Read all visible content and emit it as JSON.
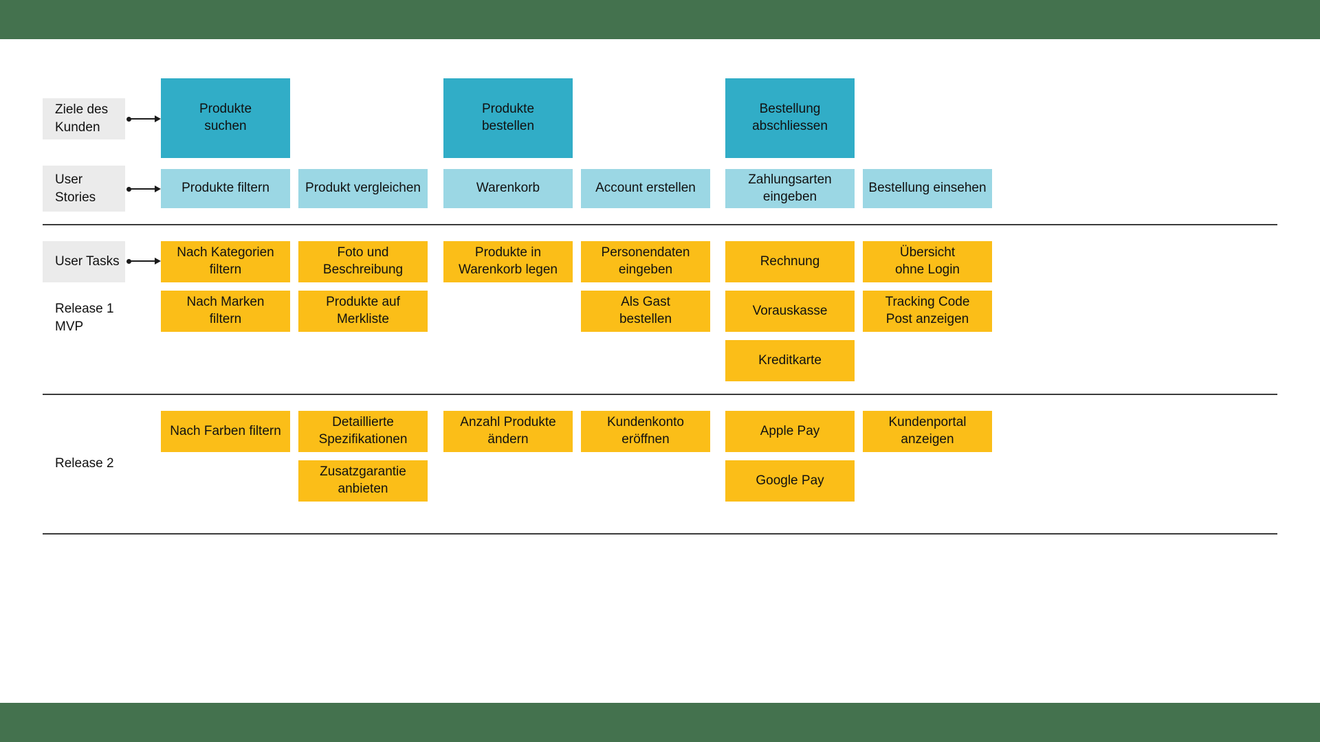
{
  "theme": {
    "band_color": "#44724E",
    "goal_color": "#31ADC7",
    "story_color": "#9BD7E4",
    "task_color": "#FBBE18",
    "label_bg": "#EBEBEB",
    "rule_color": "#3B3B3B",
    "text_color": "#111111"
  },
  "row_labels": {
    "goals": "Ziele des\nKunden",
    "goals_line1": "Ziele des",
    "goals_line2": "Kunden",
    "stories_line1": "User",
    "stories_line2": "Stories",
    "tasks": "User Tasks",
    "release1_line1": "Release 1",
    "release1_line2": "MVP",
    "release2": "Release 2"
  },
  "columns": [
    {
      "index": 0,
      "goal": "Produkte\nsuchen",
      "story": "Produkte filtern"
    },
    {
      "index": 1,
      "goal": null,
      "story": "Produkt vergleichen"
    },
    {
      "index": 2,
      "goal": "Produkte\nbestellen",
      "story": "Warenkorb"
    },
    {
      "index": 3,
      "goal": null,
      "story": "Account erstellen"
    },
    {
      "index": 4,
      "goal": "Bestellung\nabschliessen",
      "story": "Zahlungsarten\neingeben"
    },
    {
      "index": 5,
      "goal": null,
      "story": "Bestellung einsehen"
    }
  ],
  "goals": [
    {
      "line1": "Produkte",
      "line2": "suchen",
      "column": 0
    },
    {
      "line1": "Produkte",
      "line2": "bestellen",
      "column": 2
    },
    {
      "line1": "Bestellung",
      "line2": "abschliessen",
      "column": 4
    }
  ],
  "stories": [
    {
      "line1": "Produkte filtern",
      "line2": "",
      "column": 0
    },
    {
      "line1": "Produkt vergleichen",
      "line2": "",
      "column": 1
    },
    {
      "line1": "Warenkorb",
      "line2": "",
      "column": 2
    },
    {
      "line1": "Account erstellen",
      "line2": "",
      "column": 3
    },
    {
      "line1": "Zahlungsarten",
      "line2": "eingeben",
      "column": 4
    },
    {
      "line1": "Bestellung einsehen",
      "line2": "",
      "column": 5
    }
  ],
  "release1": {
    "title_line1": "Release 1",
    "title_line2": "MVP",
    "cards": [
      {
        "column": 0,
        "row": 0,
        "line1": "Nach Kategorien",
        "line2": "filtern"
      },
      {
        "column": 0,
        "row": 1,
        "line1": "Nach Marken",
        "line2": "filtern"
      },
      {
        "column": 1,
        "row": 0,
        "line1": "Foto und",
        "line2": "Beschreibung"
      },
      {
        "column": 1,
        "row": 1,
        "line1": "Produkte auf",
        "line2": "Merkliste"
      },
      {
        "column": 2,
        "row": 0,
        "line1": "Produkte in",
        "line2": "Warenkorb legen"
      },
      {
        "column": 3,
        "row": 0,
        "line1": "Personendaten",
        "line2": "eingeben"
      },
      {
        "column": 3,
        "row": 1,
        "line1": "Als Gast",
        "line2": "bestellen"
      },
      {
        "column": 4,
        "row": 0,
        "line1": "Rechnung",
        "line2": ""
      },
      {
        "column": 4,
        "row": 1,
        "line1": "Vorauskasse",
        "line2": ""
      },
      {
        "column": 4,
        "row": 2,
        "line1": "Kreditkarte",
        "line2": ""
      },
      {
        "column": 5,
        "row": 0,
        "line1": "Übersicht",
        "line2": "ohne Login"
      },
      {
        "column": 5,
        "row": 1,
        "line1": "Tracking Code",
        "line2": "Post anzeigen"
      }
    ]
  },
  "release2": {
    "title": "Release 2",
    "cards": [
      {
        "column": 0,
        "row": 0,
        "line1": "Nach Farben filtern",
        "line2": ""
      },
      {
        "column": 1,
        "row": 0,
        "line1": "Detaillierte",
        "line2": "Spezifikationen"
      },
      {
        "column": 1,
        "row": 1,
        "line1": "Zusatzgarantie",
        "line2": "anbieten"
      },
      {
        "column": 2,
        "row": 0,
        "line1": "Anzahl Produkte",
        "line2": "ändern"
      },
      {
        "column": 3,
        "row": 0,
        "line1": "Kundenkonto",
        "line2": "eröffnen"
      },
      {
        "column": 4,
        "row": 0,
        "line1": "Apple Pay",
        "line2": ""
      },
      {
        "column": 4,
        "row": 1,
        "line1": "Google Pay",
        "line2": ""
      },
      {
        "column": 5,
        "row": 0,
        "line1": "Kundenportal",
        "line2": "anzeigen"
      }
    ]
  }
}
